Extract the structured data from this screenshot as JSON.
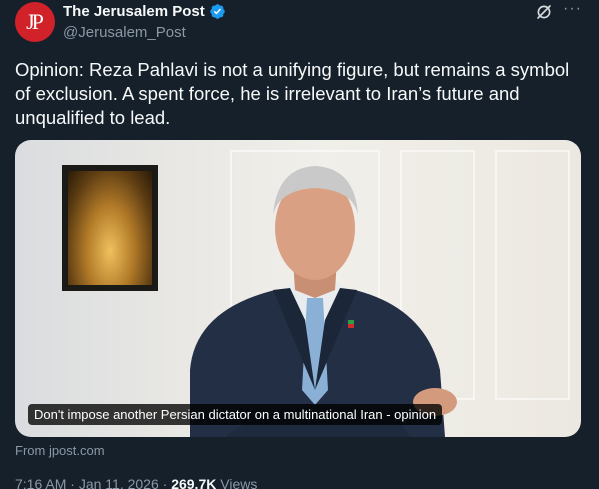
{
  "account": {
    "avatar_text": "JP",
    "display_name": "The Jerusalem Post",
    "handle": "@Jerusalem_Post",
    "verified": true
  },
  "header_icons": {
    "grok": "grok-icon",
    "more": "···"
  },
  "tweet": {
    "text": "Opinion: Reza Pahlavi is not a unifying figure, but remains a symbol of exclusion. A spent force, he is irrelevant to Iran’s future and unqualified to lead."
  },
  "card": {
    "caption": "Don't impose another Persian dictator on a multinational Iran - opinion",
    "source": "From jpost.com"
  },
  "meta": {
    "time": "7:16 AM",
    "separator": " · ",
    "date": "Jan 11, 2026",
    "views_count": "269.7K",
    "views_label": " Views"
  },
  "colors": {
    "background": "#15202b",
    "text": "#f7f9f9",
    "secondary": "#8b98a5",
    "verified": "#1d9bf0",
    "brand": "#d22229"
  }
}
